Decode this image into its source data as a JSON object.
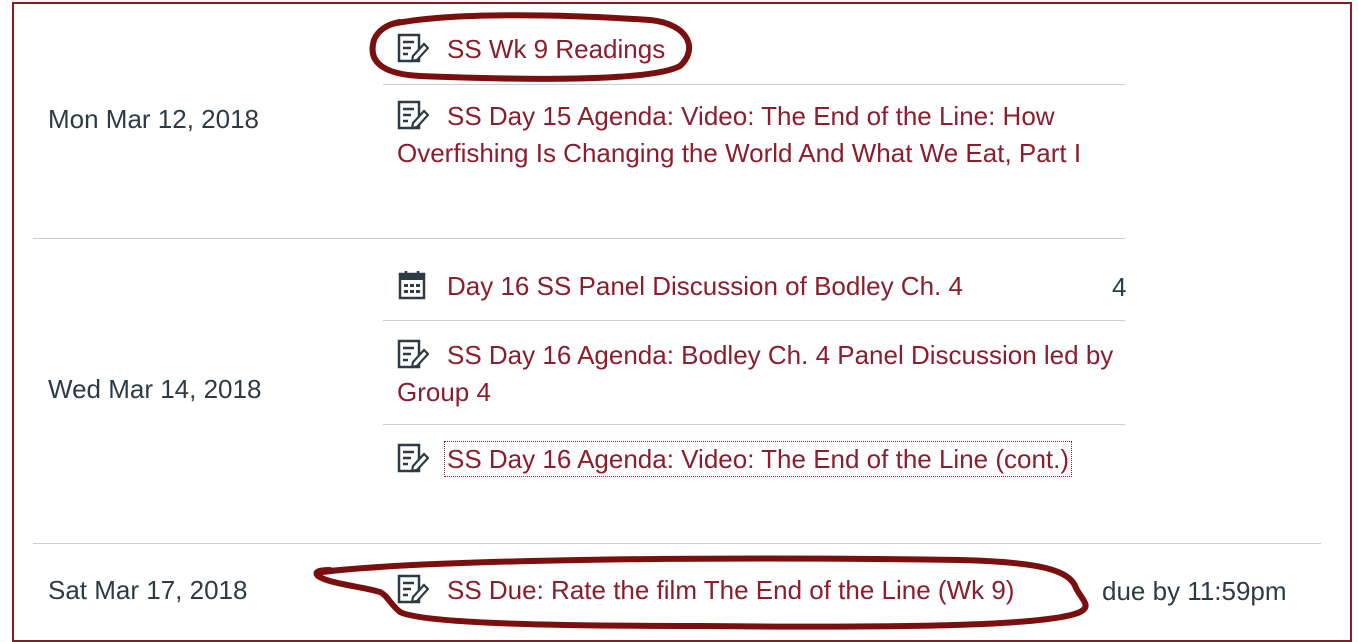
{
  "icons": {
    "assignment": "assignment-icon",
    "calendar": "calendar-event-icon"
  },
  "colors": {
    "link": "#8b1d2c",
    "text": "#2d3b45",
    "annotation": "#7a0f0f",
    "divider": "#c7cdd1"
  },
  "days": [
    {
      "date": "Mon Mar 12, 2018",
      "items": [
        {
          "title": "SS Wk 9 Readings",
          "icon": "assignment-icon"
        },
        {
          "title": "SS Day 15 Agenda: Video: The End of the Line: How Overfishing Is Changing the World And What We Eat, Part I",
          "icon": "assignment-icon"
        }
      ]
    },
    {
      "date": "Wed Mar 14, 2018",
      "items": [
        {
          "title": "Day 16 SS Panel Discussion of Bodley Ch. 4",
          "icon": "calendar-event-icon",
          "extra": "4"
        },
        {
          "title": "SS Day 16 Agenda: Bodley Ch. 4 Panel Discussion led by Group 4",
          "icon": "assignment-icon"
        },
        {
          "title": "SS Day 16 Agenda: Video: The End of the Line (cont.)",
          "icon": "assignment-icon"
        }
      ]
    },
    {
      "date": "Sat Mar 17, 2018",
      "items": [
        {
          "title": "SS Due: Rate the film The End of the Line (Wk 9)",
          "icon": "assignment-icon",
          "due": "due by 11:59pm"
        }
      ]
    }
  ]
}
